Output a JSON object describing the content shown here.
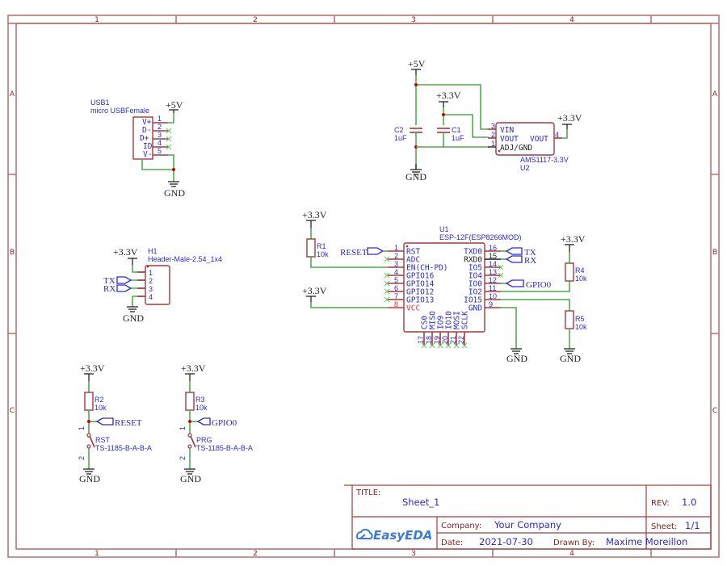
{
  "frame": {
    "columns": [
      "1",
      "2",
      "3",
      "4"
    ],
    "rows": [
      "A",
      "B",
      "C"
    ]
  },
  "title_block": {
    "title_label": "TITLE:",
    "title_value": "Sheet_1",
    "rev_label": "REV:",
    "rev_value": "1.0",
    "company_label": "Company:",
    "company_value": "Your Company",
    "sheet_label": "Sheet:",
    "sheet_value": "1/1",
    "date_label": "Date:",
    "date_value": "2021-07-30",
    "drawn_by_label": "Drawn By:",
    "drawn_by_value": "Maxime Moreillon",
    "logo_text": "EasyEDA"
  },
  "power": {
    "p5v": "+5V",
    "p33v": "+3.3V",
    "gnd": "GND"
  },
  "usb1": {
    "designator": "USB1",
    "value": "micro USBFemale",
    "pins": [
      {
        "num": "1",
        "name": "V+"
      },
      {
        "num": "2",
        "name": "D-"
      },
      {
        "num": "3",
        "name": "D+"
      },
      {
        "num": "4",
        "name": "ID"
      },
      {
        "num": "5",
        "name": "V-"
      }
    ]
  },
  "u2": {
    "designator": "U2",
    "value": "AMS1117-3.3V",
    "pins": [
      {
        "num": "3",
        "name": "VIN"
      },
      {
        "num": "2",
        "name": "VOUT"
      },
      {
        "num": "1",
        "name": "ADJ/GND"
      },
      {
        "num": "4",
        "name": "VOUT"
      }
    ]
  },
  "c1": {
    "designator": "C1",
    "value": "1uF"
  },
  "c2": {
    "designator": "C2",
    "value": "1uF"
  },
  "h1": {
    "designator": "H1",
    "value": "Header-Male-2.54_1x4",
    "pins": [
      "1",
      "2",
      "3",
      "4"
    ]
  },
  "u1": {
    "designator": "U1",
    "value": "ESP-12F(ESP8266MOD)",
    "left_pins": [
      {
        "num": "1",
        "name": "RST"
      },
      {
        "num": "2",
        "name": "ADC"
      },
      {
        "num": "3",
        "name": "EN(CH-PD)"
      },
      {
        "num": "4",
        "name": "GPIO16"
      },
      {
        "num": "5",
        "name": "GPIO14"
      },
      {
        "num": "6",
        "name": "GPIO12"
      },
      {
        "num": "7",
        "name": "GPIO13"
      },
      {
        "num": "8",
        "name": "VCC"
      }
    ],
    "right_pins": [
      {
        "num": "16",
        "name": "TXD0"
      },
      {
        "num": "15",
        "name": "RXD0"
      },
      {
        "num": "14",
        "name": "IO5"
      },
      {
        "num": "13",
        "name": "IO4"
      },
      {
        "num": "12",
        "name": "IO0"
      },
      {
        "num": "11",
        "name": "IO2"
      },
      {
        "num": "10",
        "name": "IO15"
      },
      {
        "num": "9",
        "name": "GND"
      }
    ],
    "bottom_pins": [
      {
        "num": "17",
        "name": "CS0"
      },
      {
        "num": "18",
        "name": "MISO"
      },
      {
        "num": "19",
        "name": "IO9"
      },
      {
        "num": "20",
        "name": "IO10"
      },
      {
        "num": "21",
        "name": "MOSI"
      },
      {
        "num": "22",
        "name": "SCLK"
      }
    ]
  },
  "r1": {
    "designator": "R1",
    "value": "10k"
  },
  "r2": {
    "designator": "R2",
    "value": "10k"
  },
  "r3": {
    "designator": "R3",
    "value": "10k"
  },
  "r4": {
    "designator": "R4",
    "value": "10k"
  },
  "r5": {
    "designator": "R5",
    "value": "10k"
  },
  "sw_rst": {
    "designator": "RST",
    "value": "TS-1185-B-A-B-A",
    "pin1": "1",
    "pin2": "2"
  },
  "sw_prg": {
    "designator": "PRG",
    "value": "TS-1185-B-A-B-A",
    "pin1": "1",
    "pin2": "2"
  },
  "nets": {
    "reset": "RESET",
    "gpio0": "GPIO0",
    "tx": "TX",
    "rx": "RX"
  },
  "colors": {
    "wire": "#52a852",
    "pin": "#a33a3a",
    "text_blue": "#2a2ad0",
    "frame": "#b76b6b",
    "junction": "#cc0000"
  }
}
